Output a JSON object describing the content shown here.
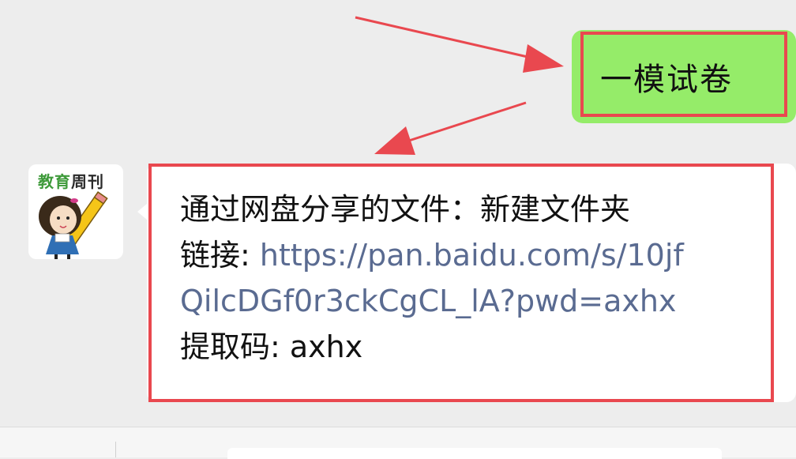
{
  "chat": {
    "outgoing": {
      "text": "一模试卷"
    },
    "incoming": {
      "sender_avatar": {
        "label_part1": "教育",
        "label_part2": "周刊"
      },
      "line1": "通过网盘分享的文件：新建文件夹",
      "link_label": "链接: ",
      "link_url_part1": "https://pan.baidu.com/s/10jf",
      "link_url_part2": "QilcDGf0r3ckCgCL_lA?pwd=axhx",
      "code_line": "提取码: axhx"
    }
  },
  "colors": {
    "background": "#ededed",
    "outgoing_bubble": "#95ec69",
    "incoming_bubble": "#ffffff",
    "highlight": "#e9484f",
    "link": "#5a6b91"
  }
}
